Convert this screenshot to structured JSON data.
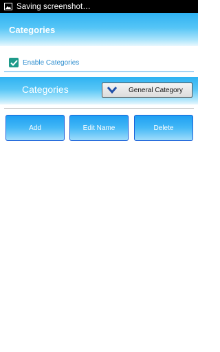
{
  "status_bar": {
    "text": "Saving screenshot…",
    "icon": "image-icon"
  },
  "action_bar": {
    "title": "Categories"
  },
  "settings": {
    "enable_label": "Enable Categories",
    "checked": true
  },
  "category_bar": {
    "label": "Categories",
    "dropdown": {
      "selected": "General Category",
      "icon": "chevron-down-icon"
    }
  },
  "buttons": {
    "add": "Add",
    "edit": "Edit Name",
    "delete": "Delete"
  },
  "colors": {
    "accent": "#2fb2f2",
    "checkbox": "#1e9a8a",
    "label_blue": "#2e8ecf",
    "button_border": "#1a5fd8"
  }
}
